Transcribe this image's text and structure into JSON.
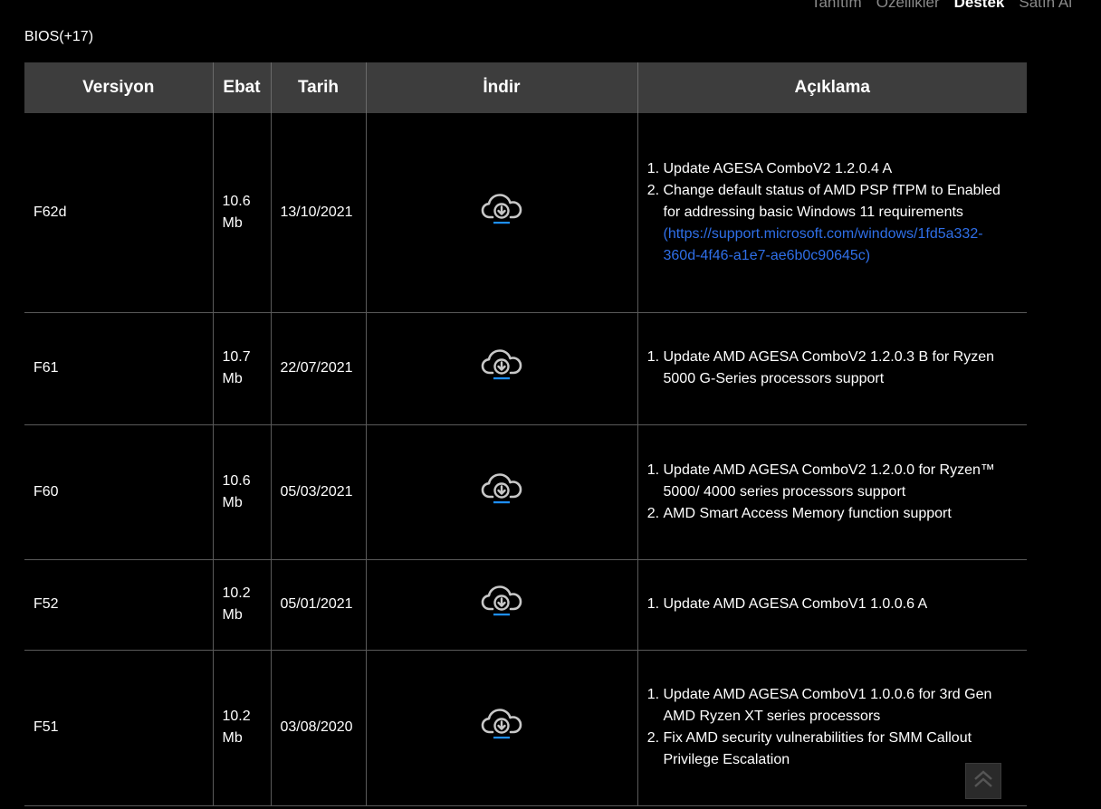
{
  "nav": {
    "items": [
      "Tanıtım",
      "Özellikler",
      "Destek",
      "Satın Al"
    ],
    "active_index": 2
  },
  "section": {
    "title": "BIOS(+17)"
  },
  "table": {
    "headers": {
      "version": "Versiyon",
      "size": "Ebat",
      "date": "Tarih",
      "download": "İndir",
      "description": "Açıklama"
    },
    "rows": [
      {
        "version": "F62d",
        "size_value": "10.6",
        "size_unit": "Mb",
        "date": "13/10/2021",
        "desc": [
          "Update AGESA ComboV2 1.2.0.4 A",
          "Change default status of AMD PSP fTPM to Enabled for addressing basic Windows 11 requirements"
        ],
        "link": "(https://support.microsoft.com/windows/1fd5a332-360d-4f46-a1e7-ae6b0c90645c)"
      },
      {
        "version": "F61",
        "size_value": "10.7",
        "size_unit": "Mb",
        "date": "22/07/2021",
        "desc": [
          "Update AMD AGESA ComboV2 1.2.0.3 B for Ryzen 5000 G-Series processors support"
        ]
      },
      {
        "version": "F60",
        "size_value": "10.6",
        "size_unit": "Mb",
        "date": "05/03/2021",
        "desc": [
          "Update AMD AGESA ComboV2 1.2.0.0 for Ryzen™ 5000/ 4000 series processors support",
          "AMD Smart Access Memory function support"
        ]
      },
      {
        "version": "F52",
        "size_value": "10.2",
        "size_unit": "Mb",
        "date": "05/01/2021",
        "desc": [
          "Update AMD AGESA ComboV1 1.0.0.6 A"
        ]
      },
      {
        "version": "F51",
        "size_value": "10.2",
        "size_unit": "Mb",
        "date": "03/08/2020",
        "desc": [
          "Update AMD AGESA ComboV1 1.0.0.6 for 3rd Gen AMD Ryzen XT series processors",
          "Fix AMD security vulnerabilities for SMM Callout Privilege Escalation"
        ]
      }
    ]
  },
  "colors": {
    "background": "#000000",
    "header_bg": "#3d3d3d",
    "link": "#2f6fe8",
    "download_accent": "#1e90ff"
  },
  "icons": {
    "download": "cloud-download-icon",
    "back_to_top": "double-chevron-up-icon"
  }
}
